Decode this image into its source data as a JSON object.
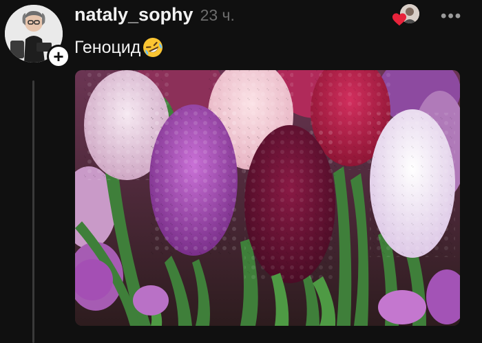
{
  "post": {
    "username": "nataly_sophy",
    "timestamp": "23 ч.",
    "text": "Геноцид",
    "follow_symbol": "+",
    "more_symbol": "•••"
  },
  "icons": {
    "avatar": "profile-avatar",
    "follow": "plus-icon",
    "emoji": "rolling-laughing-emoji",
    "liker": "liked-by-avatar",
    "heart": "heart-icon",
    "more": "more-dots-icon"
  },
  "colors": {
    "background": "#101010",
    "username": "#f2f2f2",
    "timestamp": "#6d6d6d",
    "heart": "#e8233b"
  }
}
